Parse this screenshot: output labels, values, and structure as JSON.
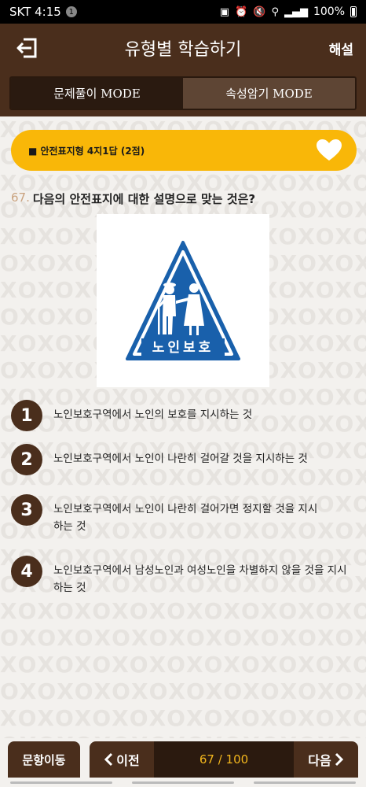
{
  "status_bar": {
    "carrier_time": "SKT 4:15",
    "notification_count": "1",
    "battery": "100%"
  },
  "header": {
    "title": "유형별 학습하기",
    "action_label": "해설",
    "icons": {
      "back": "exit-arrow-icon"
    }
  },
  "mode_tabs": [
    {
      "label": "문제풀이 MODE",
      "active": true
    },
    {
      "label": "속성암기 MODE",
      "active": false
    }
  ],
  "category": {
    "label": "■ 안전표지형 4지1답 (2점)",
    "icon": "heart-icon"
  },
  "question": {
    "number": "67.",
    "text": "다음의 안전표지에 대한 설명으로 맞는 것은?"
  },
  "sign": {
    "caption": "노인보호",
    "colors": {
      "triangle_fill": "#1960ab",
      "triangle_border": "#ffffff",
      "outline": "#1960ab"
    }
  },
  "answers": [
    {
      "num": "1",
      "text": "노인보호구역에서 노인의 보호를 지시하는 것"
    },
    {
      "num": "2",
      "text": "노인보호구역에서 노인이 나란히 걸어갈 것을 지시하는 것"
    },
    {
      "num": "3",
      "text": "노인보호구역에서 노인이 나란히 걸어가면 정지할 것을 지시하는 것"
    },
    {
      "num": "4",
      "text": "노인보호구역에서 남성노인과 여성노인을 차별하지 않을 것을 지시하는 것"
    }
  ],
  "bottom": {
    "move_label": "문항이동",
    "prev_label": "이전",
    "next_label": "다음",
    "page": "67 / 100"
  },
  "colors": {
    "brand_brown": "#4a2e1c",
    "accent_yellow": "#f9b708",
    "page_counter": "#f2b61d"
  }
}
